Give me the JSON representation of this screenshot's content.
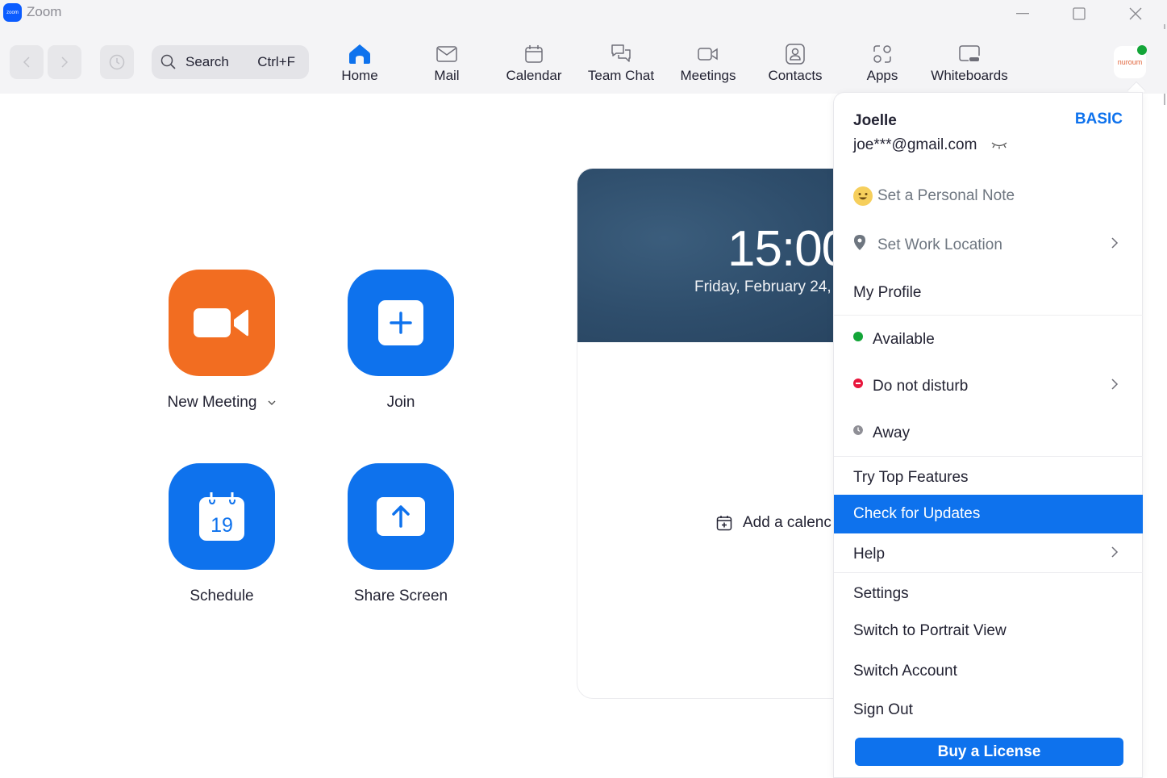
{
  "window": {
    "app_title": "Zoom",
    "logo_text": "zoom"
  },
  "toolbar": {
    "search": {
      "label": "Search",
      "shortcut": "Ctrl+F"
    },
    "tabs": [
      {
        "label": "Home",
        "icon": "home-icon",
        "active": true
      },
      {
        "label": "Mail",
        "icon": "mail-icon"
      },
      {
        "label": "Calendar",
        "icon": "calendar-icon"
      },
      {
        "label": "Team Chat",
        "icon": "chat-icon"
      },
      {
        "label": "Meetings",
        "icon": "video-icon"
      },
      {
        "label": "Contacts",
        "icon": "contacts-icon"
      },
      {
        "label": "Apps",
        "icon": "apps-icon"
      },
      {
        "label": "Whiteboards",
        "icon": "whiteboard-icon"
      }
    ],
    "avatar_text": "nuroum",
    "presence_color": "#13a538"
  },
  "actions": [
    {
      "label": "New Meeting",
      "color": "#f26d21",
      "icon": "video-camera-icon",
      "has_dropdown": true
    },
    {
      "label": "Join",
      "color": "#0e72ed",
      "icon": "plus-icon"
    },
    {
      "label": "Schedule",
      "color": "#0e72ed",
      "icon": "calendar-icon",
      "calendar_day": "19"
    },
    {
      "label": "Share Screen",
      "color": "#0e72ed",
      "icon": "share-up-arrow-icon"
    }
  ],
  "calendar_card": {
    "time": "15:00",
    "date": "Friday, February 24,",
    "add_calendar": "Add a calenc"
  },
  "profile_menu": {
    "name": "Joelle",
    "plan": "BASIC",
    "email": "joe***@gmail.com",
    "personal_note": "Set a Personal Note",
    "work_location": "Set Work Location",
    "my_profile": "My Profile",
    "statuses": [
      {
        "label": "Available",
        "color": "#13a538"
      },
      {
        "label": "Do not disturb",
        "color": "#e8173d",
        "has_submenu": true
      },
      {
        "label": "Away",
        "color": "#8f8f96"
      }
    ],
    "try_top_features": "Try Top Features",
    "check_updates": "Check for Updates",
    "help": "Help",
    "settings": "Settings",
    "portrait_view": "Switch to Portrait View",
    "switch_account": "Switch Account",
    "sign_out": "Sign Out",
    "buy_license": "Buy a License"
  },
  "colors": {
    "accent": "#0e72ed",
    "orange": "#f26d21",
    "toolbar_bg": "#f4f4f6"
  }
}
